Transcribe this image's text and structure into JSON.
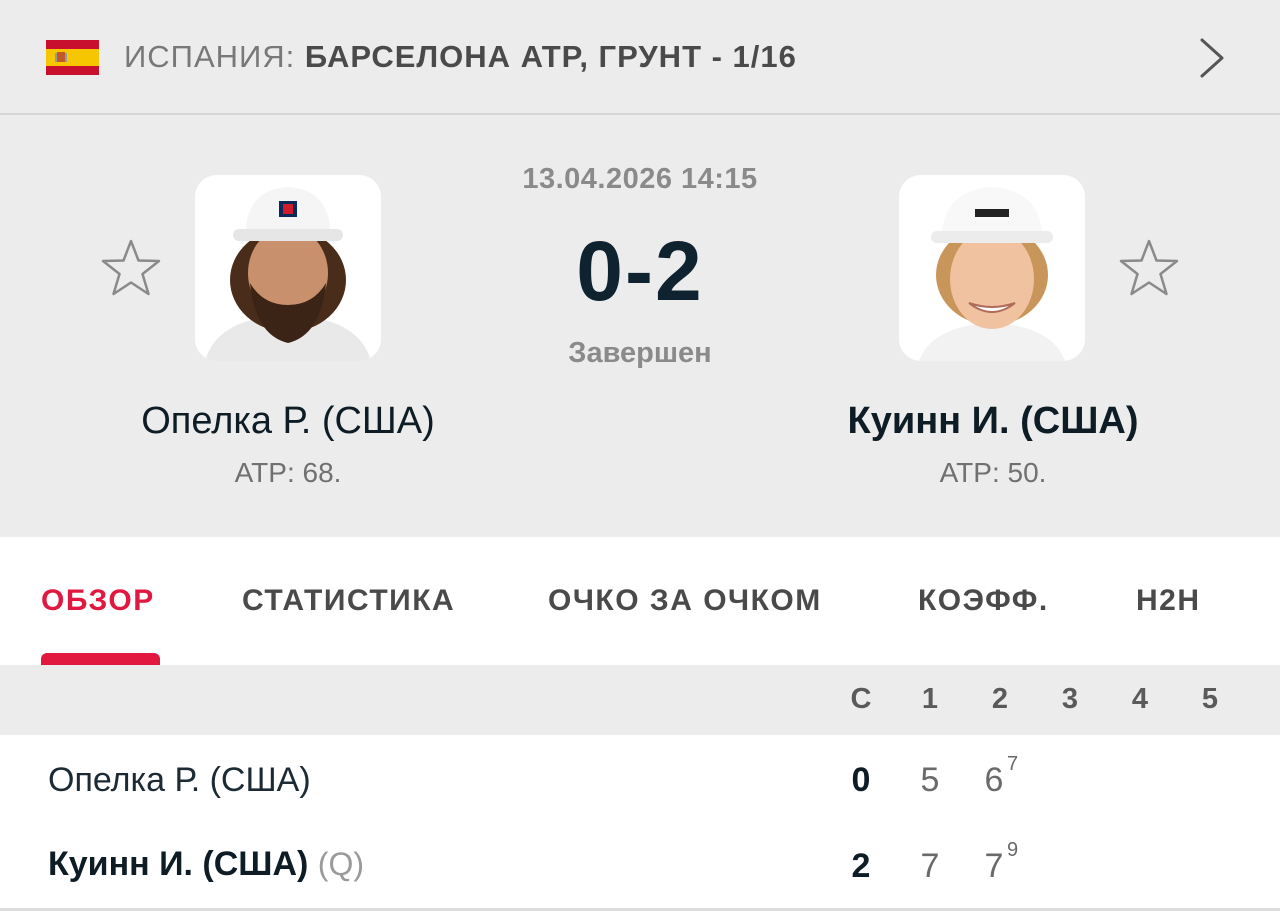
{
  "header": {
    "country": "ИСПАНИЯ:",
    "tournament": "БАРСЕЛОНА ATP, ГРУНТ - 1/16",
    "flag_icon": "spain-flag",
    "nav_icon": "chevron-right-icon"
  },
  "match": {
    "date": "13.04.2026 14:15",
    "score": "0-2",
    "status": "Завершен",
    "home": {
      "name": "Опелка Р. (США)",
      "rank": "ATP: 68."
    },
    "away": {
      "name": "Куинн И. (США)",
      "rank": "ATP: 50."
    }
  },
  "tabs": [
    {
      "label": "ОБЗОР",
      "active": true
    },
    {
      "label": "СТАТИСТИКА",
      "active": false
    },
    {
      "label": "ОЧКО ЗА ОЧКОМ",
      "active": false
    },
    {
      "label": "КОЭФФ.",
      "active": false
    },
    {
      "label": "H2H",
      "active": false
    }
  ],
  "scoreboard": {
    "columns": [
      "С",
      "1",
      "2",
      "3",
      "4",
      "5"
    ],
    "rows": [
      {
        "name": "Опелка Р. (США)",
        "qualifier": "",
        "sets": "0",
        "set1": "5",
        "set2": "6",
        "set2_tiebreak": "7"
      },
      {
        "name": "Куинн И. (США)",
        "qualifier": "(Q)",
        "sets": "2",
        "set1": "7",
        "set2": "7",
        "set2_tiebreak": "9"
      }
    ]
  },
  "colors": {
    "accent": "#e1183f",
    "score": "#0e2230",
    "background": "#ececec"
  }
}
